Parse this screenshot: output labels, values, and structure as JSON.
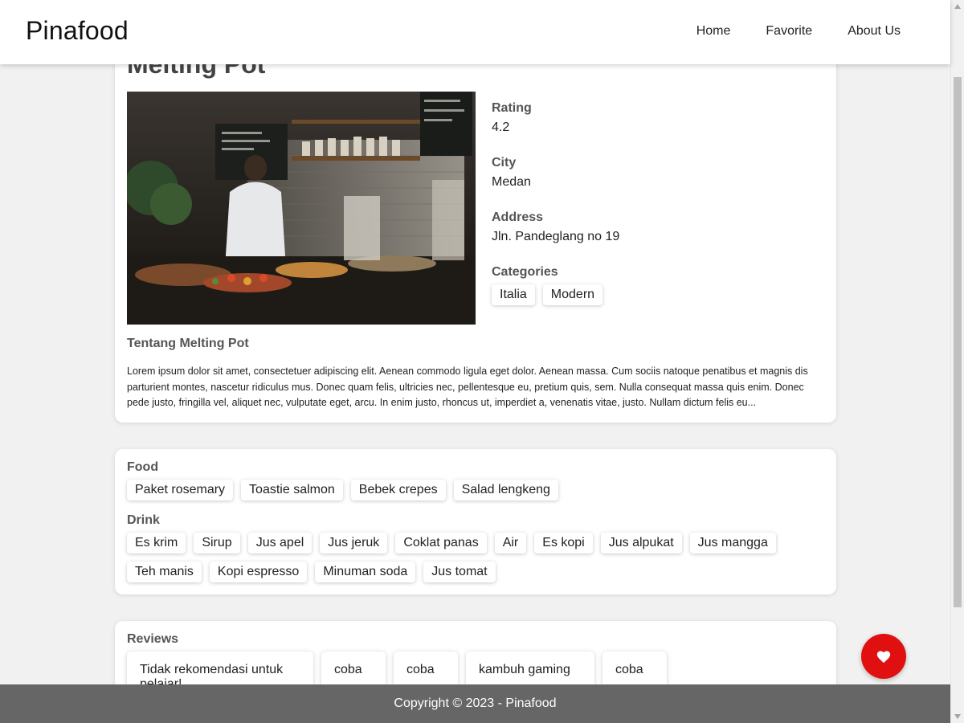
{
  "header": {
    "brand": "Pinafood",
    "nav": [
      {
        "label": "Home"
      },
      {
        "label": "Favorite"
      },
      {
        "label": "About Us"
      }
    ]
  },
  "restaurant": {
    "name": "Melting Pot",
    "rating_label": "Rating",
    "rating": "4.2",
    "city_label": "City",
    "city": "Medan",
    "address_label": "Address",
    "address": "Jln. Pandeglang no 19",
    "categories_label": "Categories",
    "categories": [
      "Italia",
      "Modern"
    ],
    "about_title": "Tentang Melting Pot",
    "about_text": "Lorem ipsum dolor sit amet, consectetuer adipiscing elit. Aenean commodo ligula eget dolor. Aenean massa. Cum sociis natoque penatibus et magnis dis parturient montes, nascetur ridiculus mus. Donec quam felis, ultricies nec, pellentesque eu, pretium quis, sem. Nulla consequat massa quis enim. Donec pede justo, fringilla vel, aliquet nec, vulputate eget, arcu. In enim justo, rhoncus ut, imperdiet a, venenatis vitae, justo. Nullam dictum felis eu..."
  },
  "menu": {
    "food_label": "Food",
    "foods": [
      "Paket rosemary",
      "Toastie salmon",
      "Bebek crepes",
      "Salad lengkeng"
    ],
    "drink_label": "Drink",
    "drinks": [
      "Es krim",
      "Sirup",
      "Jus apel",
      "Jus jeruk",
      "Coklat panas",
      "Air",
      "Es kopi",
      "Jus alpukat",
      "Jus mangga",
      "Teh manis",
      "Kopi espresso",
      "Minuman soda",
      "Jus tomat"
    ]
  },
  "reviews": {
    "label": "Reviews",
    "items": [
      {
        "text": "Tidak rekomendasi untuk pelajar!"
      },
      {
        "text": "coba"
      },
      {
        "text": "coba"
      },
      {
        "text": "kambuh gaming"
      },
      {
        "text": "coba"
      }
    ]
  },
  "footer": {
    "copyright": "Copyright © 2023 - Pinafood"
  },
  "fab": {
    "icon": "heart-icon",
    "color": "#e01010"
  },
  "colors": {
    "footer_bg": "#666666",
    "fab": "#e01010"
  }
}
